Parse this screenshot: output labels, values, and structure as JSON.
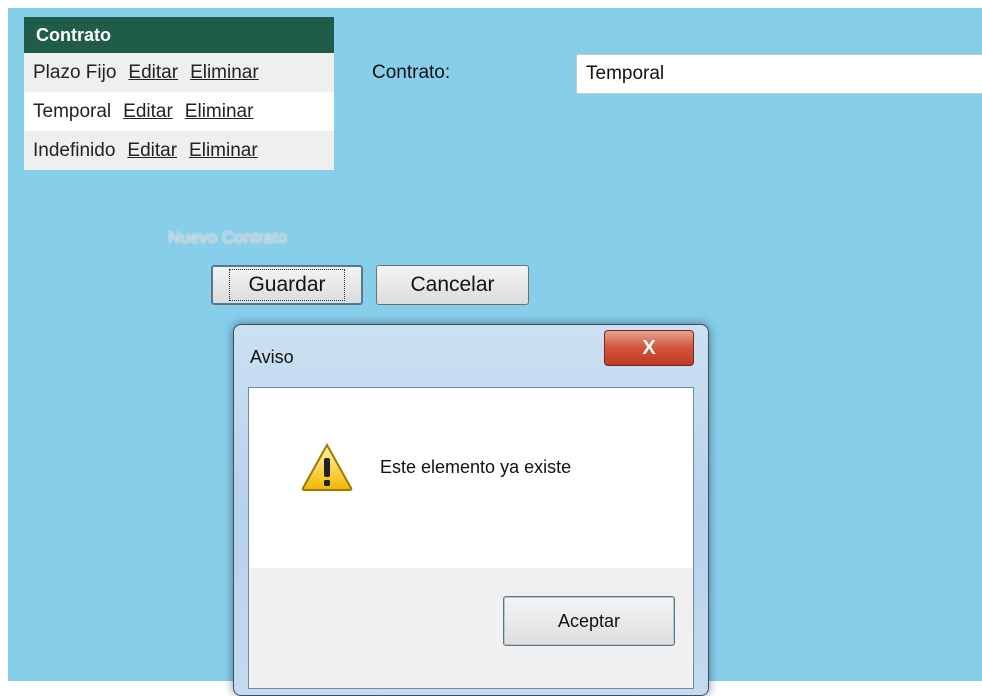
{
  "table": {
    "header": "Contrato",
    "rows": [
      {
        "name": "Plazo Fijo",
        "edit": "Editar",
        "delete": "Eliminar"
      },
      {
        "name": "Temporal",
        "edit": "Editar",
        "delete": "Eliminar"
      },
      {
        "name": "Indefinido",
        "edit": "Editar",
        "delete": "Eliminar"
      }
    ],
    "new_link": "Nuevo Contrato"
  },
  "form": {
    "label": "Contrato:",
    "value": "Temporal",
    "save_label": "Guardar",
    "cancel_label": "Cancelar"
  },
  "dialog": {
    "title": "Aviso",
    "close_label": "X",
    "message": "Este elemento ya existe",
    "icon": "warning-icon",
    "accept_label": "Aceptar"
  },
  "colors": {
    "page_background": "#87ceeb",
    "table_header": "#1f5c4a",
    "close_button": "#c23b22"
  }
}
